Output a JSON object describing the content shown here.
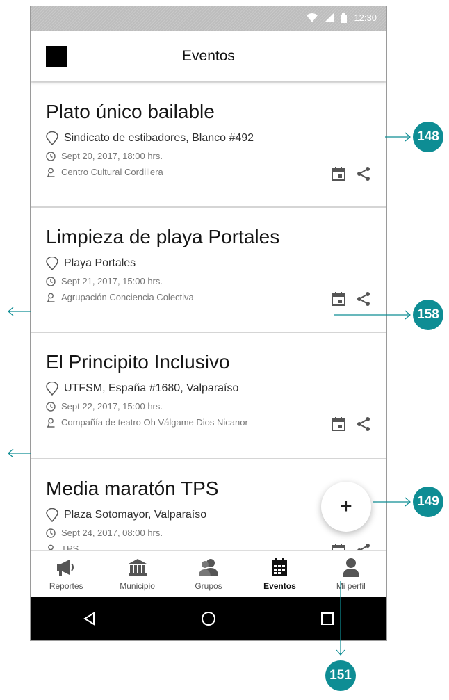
{
  "status": {
    "time": "12:30"
  },
  "appbar": {
    "title": "Eventos"
  },
  "events": [
    {
      "title": "Plato único bailable",
      "place": "Sindicato de estibadores, Blanco #492",
      "date": "Sept 20, 2017, 18:00 hrs.",
      "org": "Centro Cultural Cordillera"
    },
    {
      "title": "Limpieza de playa Portales",
      "place": "Playa Portales",
      "date": "Sept 21, 2017, 15:00 hrs.",
      "org": "Agrupación Conciencia Colectiva"
    },
    {
      "title": "El Principito Inclusivo",
      "place": "UTFSM, España #1680, Valparaíso",
      "date": "Sept 22, 2017, 15:00 hrs.",
      "org": "Compañía de teatro Oh Válgame Dios Nicanor"
    },
    {
      "title": "Media maratón TPS",
      "place": "Plaza Sotomayor, Valparaíso",
      "date": "Sept 24, 2017, 08:00 hrs.",
      "org": "TPS"
    }
  ],
  "fab": {
    "label": "+"
  },
  "nav": [
    {
      "label": "Reportes",
      "icon": "megaphone-icon"
    },
    {
      "label": "Municipio",
      "icon": "building-icon"
    },
    {
      "label": "Grupos",
      "icon": "group-icon"
    },
    {
      "label": "Eventos",
      "icon": "calendar-icon"
    },
    {
      "label": "Mi perfil",
      "icon": "person-icon"
    }
  ],
  "annotations": {
    "a148": "148",
    "a158": "158",
    "a149": "149",
    "a151": "151"
  },
  "colors": {
    "accent": "#0e8d94"
  }
}
